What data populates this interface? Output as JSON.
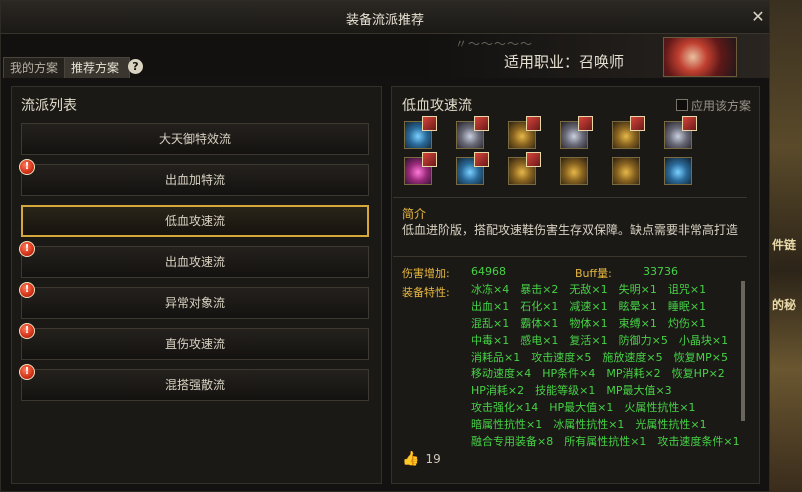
{
  "window": {
    "title": "装备流派推荐",
    "close_label": "✕"
  },
  "header": {
    "job_label": "适用职业：召唤师"
  },
  "tabs": [
    {
      "label": "我的方案"
    },
    {
      "label": "推荐方案"
    }
  ],
  "help_label": "?",
  "left_panel": {
    "title": "流派列表",
    "items": [
      {
        "label": "大天御特效流",
        "warning": false
      },
      {
        "label": "出血加特流",
        "warning": true
      },
      {
        "label": "低血攻速流",
        "warning": false,
        "selected": true
      },
      {
        "label": "出血攻速流",
        "warning": true
      },
      {
        "label": "异常对象流",
        "warning": true
      },
      {
        "label": "直伤攻速流",
        "warning": true
      },
      {
        "label": "混搭强散流",
        "warning": true
      }
    ],
    "warning_symbol": "!"
  },
  "right_panel": {
    "title": "低血攻速流",
    "apply_label": "应用该方案",
    "intro_label": "简介",
    "intro_text": "低血进阶版，搭配攻速鞋伤害生存双保障。缺点需要非常高打造",
    "damage_label": "伤害增加:",
    "damage_value": "64968",
    "buff_label": "Buff量:",
    "buff_value": "33736",
    "traits_label": "装备特性:",
    "traits": [
      "冰冻×4　暴击×2　无敌×1　失明×1　诅咒×1",
      "出血×1　石化×1　减速×1　眩晕×1　睡眠×1",
      "混乱×1　霸体×1　物体×1　束缚×1　灼伤×1",
      "中毒×1　感电×1　复活×1　防御力×5　小晶块×1",
      "消耗品×1　攻击速度×5　施放速度×5　恢复MP×5",
      "移动速度×4　HP条件×4　MP消耗×2　恢复HP×2",
      "HP消耗×2　技能等级×1　MP最大值×3",
      "攻击强化×14　HP最大值×1　火属性抗性×1",
      "暗属性抗性×1　冰属性抗性×1　光属性抗性×1",
      "融合专用装备×8　所有属性抗性×1　攻击速度条件×1"
    ],
    "likes": "19"
  },
  "background_text": {
    "right_1": "件链",
    "right_2": "的秘"
  }
}
